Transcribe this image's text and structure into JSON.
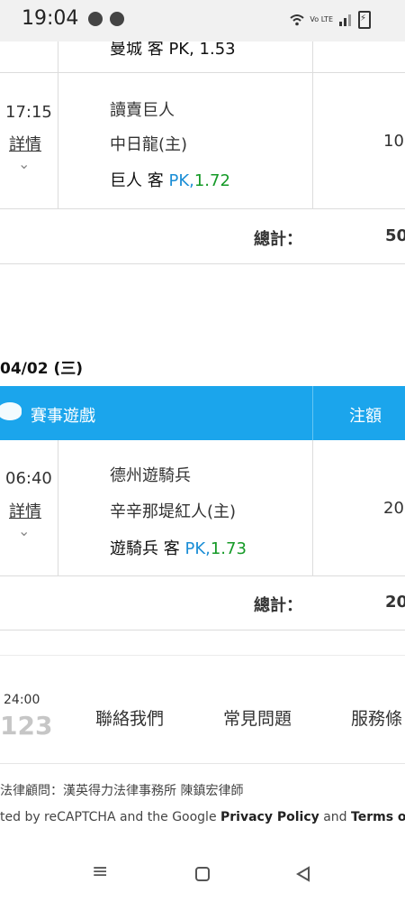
{
  "status_bar": {
    "time": "19:04",
    "left_icons": [
      "chat-bubble-icon",
      "line-app-icon"
    ],
    "right_icons": [
      "wifi-icon",
      "volte-lte-icon",
      "signal-icon",
      "battery-charging-icon"
    ],
    "volte_text": "Vo LTE"
  },
  "bets_top": {
    "partial_row_text": "曼城 客 PK, 1.53",
    "row": {
      "time": "17:15",
      "detail_label": "詳情",
      "team1": "讀賣巨人",
      "team2": "中日龍(主)",
      "bet_team": "巨人 客",
      "bet_pk": "PK,",
      "bet_odds": "1.72",
      "amount": "10"
    },
    "total_label": "總計：",
    "total_value": "50"
  },
  "day_section": {
    "date": "04/02 (三)",
    "header": {
      "label": "賽事遊戲",
      "amount_label": "注額"
    },
    "row": {
      "time": "06:40",
      "detail_label": "詳情",
      "team1": "德州遊騎兵",
      "team2": "辛辛那堤紅人(主)",
      "bet_team": "遊騎兵 客",
      "bet_pk": "PK,",
      "bet_odds": "1.73",
      "amount": "20"
    },
    "total_label": "總計：",
    "total_value": "20"
  },
  "footer": {
    "hours": "24:00",
    "phone_partial": "123",
    "links": [
      "聯絡我們",
      "常見問題",
      "服務條"
    ],
    "legal_line": "法律顧問：漢英得力法律事務所 陳鎮宏律師",
    "recaptcha": {
      "prefix": "ted by reCAPTCHA and the Google ",
      "privacy": "Privacy Policy",
      "and": " and ",
      "terms": "Terms of"
    }
  },
  "nav": {
    "items": [
      "menu-icon",
      "home-square-icon",
      "back-triangle-icon"
    ]
  },
  "colors": {
    "header_blue": "#1ba5ec",
    "pk_blue": "#1b8ed6",
    "odds_green": "#159a27"
  }
}
